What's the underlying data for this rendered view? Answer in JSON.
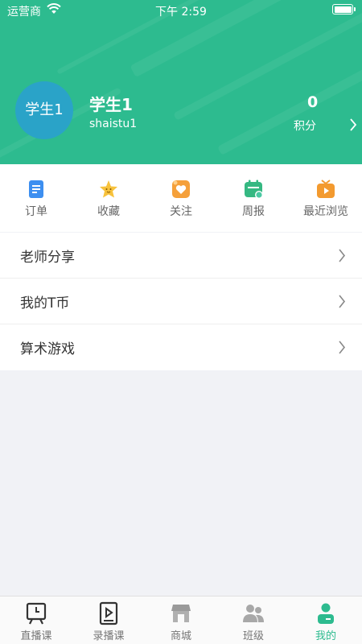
{
  "status_bar": {
    "carrier": "运营商",
    "time": "下午 2:59"
  },
  "profile": {
    "avatar_text": "学生1",
    "name": "学生1",
    "account": "shaistu1",
    "points_value": "0",
    "points_label": "积分"
  },
  "quick_actions": [
    {
      "label": "订单",
      "icon": "order-icon"
    },
    {
      "label": "收藏",
      "icon": "favorite-star-icon"
    },
    {
      "label": "关注",
      "icon": "follow-heart-icon"
    },
    {
      "label": "周报",
      "icon": "weekly-report-icon"
    },
    {
      "label": "最近浏览",
      "icon": "recent-tv-icon"
    }
  ],
  "menu": [
    {
      "label": "老师分享"
    },
    {
      "label": "我的T币"
    },
    {
      "label": "算术游戏"
    }
  ],
  "tabs": [
    {
      "label": "直播课",
      "icon": "live-class-icon",
      "active": false
    },
    {
      "label": "录播课",
      "icon": "recorded-class-icon",
      "active": false
    },
    {
      "label": "商城",
      "icon": "store-icon",
      "active": false
    },
    {
      "label": "班级",
      "icon": "class-group-icon",
      "active": false
    },
    {
      "label": "我的",
      "icon": "profile-icon",
      "active": true
    }
  ],
  "colors": {
    "brand": "#2dbb8f",
    "avatar_bg": "#2aa3c8",
    "page_bg": "#f1f2f6"
  }
}
